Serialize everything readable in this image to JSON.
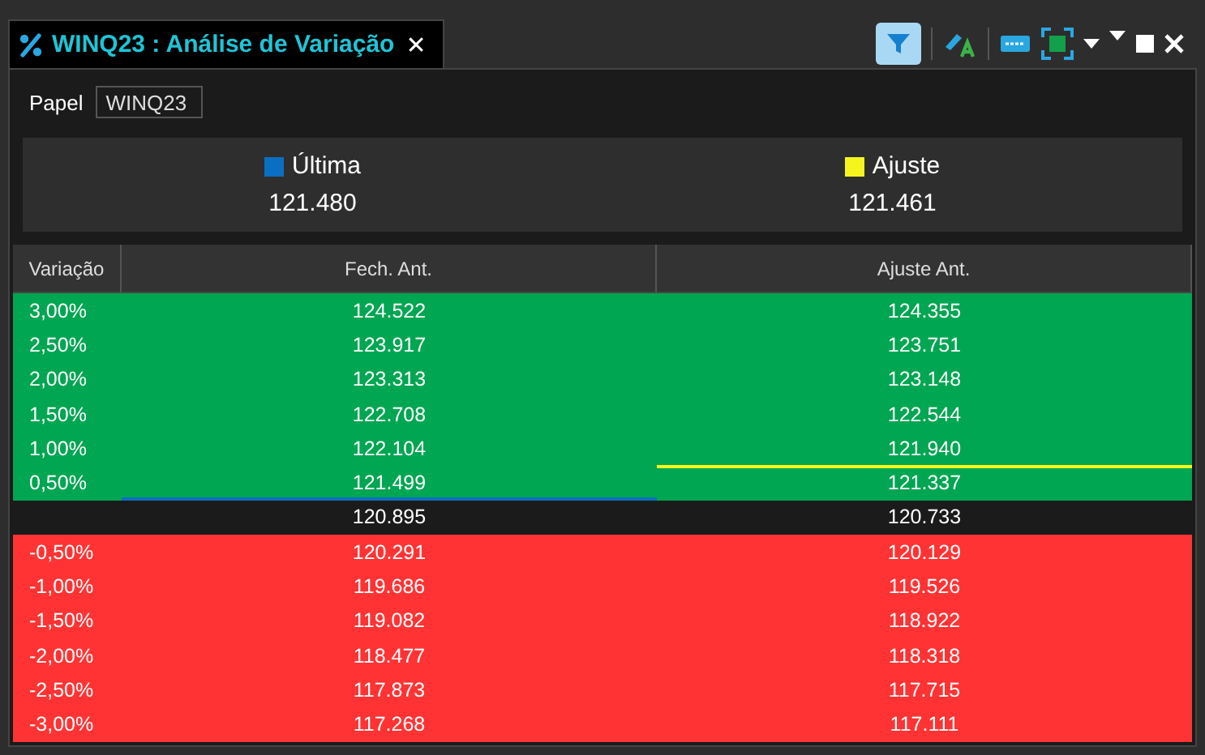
{
  "tab": {
    "title": "WINQ23 : Análise de Variação",
    "close": "✕"
  },
  "toolbar": {
    "filter_active": true
  },
  "papel": {
    "label": "Papel",
    "value": "WINQ23"
  },
  "legend": [
    {
      "name": "Última",
      "color": "#0a6fc2",
      "value": "121.480"
    },
    {
      "name": "Ajuste",
      "color": "#f5f51e",
      "value": "121.461"
    }
  ],
  "table": {
    "columns": [
      "Variação",
      "Fech. Ant.",
      "Ajuste Ant."
    ],
    "rows": [
      {
        "kind": "up",
        "cells": [
          "3,00%",
          "124.522",
          "124.355"
        ]
      },
      {
        "kind": "up",
        "cells": [
          "2,50%",
          "123.917",
          "123.751"
        ]
      },
      {
        "kind": "up",
        "cells": [
          "2,00%",
          "123.313",
          "123.148"
        ]
      },
      {
        "kind": "up",
        "cells": [
          "1,50%",
          "122.708",
          "122.544"
        ]
      },
      {
        "kind": "up",
        "cells": [
          "1,00%",
          "122.104",
          "121.940"
        ]
      },
      {
        "kind": "up",
        "cells": [
          "0,50%",
          "121.499",
          "121.337"
        ],
        "fech_line_below": true,
        "ajuste_line_above": true
      },
      {
        "kind": "flat",
        "cells": [
          null,
          "120.895",
          "120.733"
        ]
      },
      {
        "kind": "down",
        "cells": [
          "-0,50%",
          "120.291",
          "120.129"
        ]
      },
      {
        "kind": "down",
        "cells": [
          "-1,00%",
          "119.686",
          "119.526"
        ]
      },
      {
        "kind": "down",
        "cells": [
          "-1,50%",
          "119.082",
          "118.922"
        ]
      },
      {
        "kind": "down",
        "cells": [
          "-2,00%",
          "118.477",
          "118.318"
        ]
      },
      {
        "kind": "down",
        "cells": [
          "-2,50%",
          "117.873",
          "117.715"
        ]
      },
      {
        "kind": "down",
        "cells": [
          "-3,00%",
          "117.268",
          "117.111"
        ]
      }
    ]
  }
}
